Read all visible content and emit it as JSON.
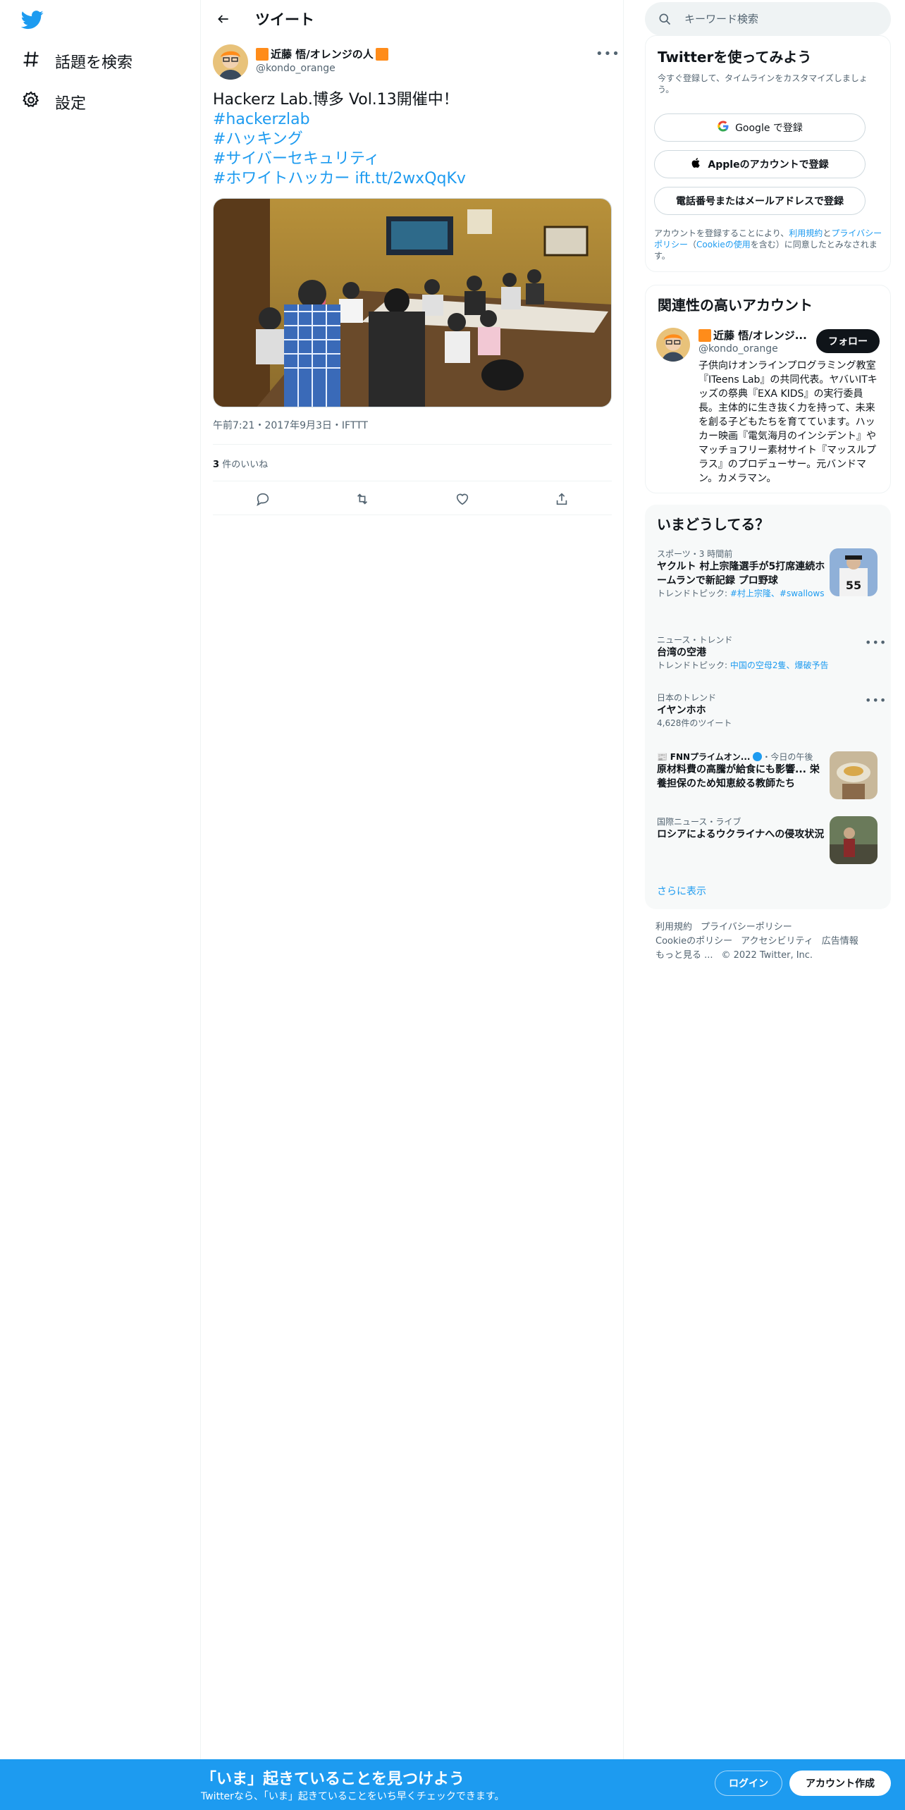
{
  "nav": {
    "items": [
      {
        "label": "話題を検索",
        "icon": "hashtag-icon"
      },
      {
        "label": "設定",
        "icon": "gear-icon"
      }
    ]
  },
  "header": {
    "title": "ツイート"
  },
  "tweet": {
    "author_name": "近藤 悟/オレンジの人",
    "author_handle": "@kondo_orange",
    "text_line1": "Hackerz Lab.博多 Vol.13開催中！",
    "hashtags": [
      "#hackerzlab",
      "#ハッキング",
      "#サイバーセキュリティ",
      "#ホワイトハッカー"
    ],
    "link": "ift.tt/2wxQqKv",
    "meta": "午前7:21・2017年9月3日・IFTTT",
    "likes_count": "3",
    "likes_label": "件のいいね"
  },
  "search": {
    "placeholder": "キーワード検索"
  },
  "signup": {
    "title": "Twitterを使ってみよう",
    "subtitle": "今すぐ登録して、タイムラインをカスタマイズしましょう。",
    "google_label": "Google で登録",
    "apple_label": "Appleのアカウントで登録",
    "phone_label": "電話番号またはメールアドレスで登録",
    "legal_prefix": "アカウントを登録することにより、",
    "legal_terms": "利用規約",
    "legal_and": "と",
    "legal_privacy": "プライバシーポリシー",
    "legal_paren_open": "（",
    "legal_cookie": "Cookieの使用",
    "legal_suffix": "を含む）に同意したとみなされます。"
  },
  "related": {
    "title": "関連性の高いアカウント",
    "name": "近藤 悟/オレンジ...",
    "handle": "@kondo_orange",
    "follow_label": "フォロー",
    "bio": "子供向けオンラインプログラミング教室『ITeens Lab』の共同代表。ヤバいITキッズの祭典『EXA KIDS』の実行委員長。主体的に生き抜く力を持って、未来を創る子どもたちを育てています。ハッカー映画『電気海月のインシデント』やマッチョフリー素材サイト『マッスルプラス』のプロデューサー。元バンドマン。カメラマン。"
  },
  "trends": {
    "title": "いまどうしてる？",
    "items": [
      {
        "category": "スポーツ・3 時間前",
        "name": "ヤクルト 村上宗隆選手が5打席連続ホームランで新記録 プロ野球",
        "sub_prefix": "トレンドトピック: ",
        "sub_links": "#村上宗隆、#swallows"
      },
      {
        "category": "ニュース・トレンド",
        "name": "台湾の空港",
        "sub_prefix": "トレンドトピック: ",
        "sub_links": "中国の空母2隻、爆破予告"
      },
      {
        "category": "日本のトレンド",
        "name": "イヤンホホ",
        "sub": "4,628件のツイート"
      },
      {
        "category": "FNNプライムオン...",
        "category_suffix": "・今日の午後",
        "name": "原材料費の高騰が給食にも影響... 栄養担保のため知恵絞る教師たち"
      },
      {
        "category": "国際ニュース・ライブ",
        "name": "ロシアによるウクライナへの侵攻状況"
      }
    ],
    "show_more": "さらに表示"
  },
  "footer": {
    "links": [
      "利用規約",
      "プライバシーポリシー",
      "Cookieのポリシー",
      "アクセシビリティ",
      "広告情報",
      "もっと見る ..."
    ],
    "copyright": "© 2022 Twitter, Inc."
  },
  "bottom_bar": {
    "title": "「いま」起きていることを見つけよう",
    "subtitle": "Twitterなら、「いま」起きていることをいち早くチェックできます。",
    "login_label": "ログイン",
    "signup_label": "アカウント作成"
  },
  "colors": {
    "accent": "#1d9bf0",
    "text": "#0f1419",
    "muted": "#536471",
    "orange": "#ff8c1a"
  }
}
